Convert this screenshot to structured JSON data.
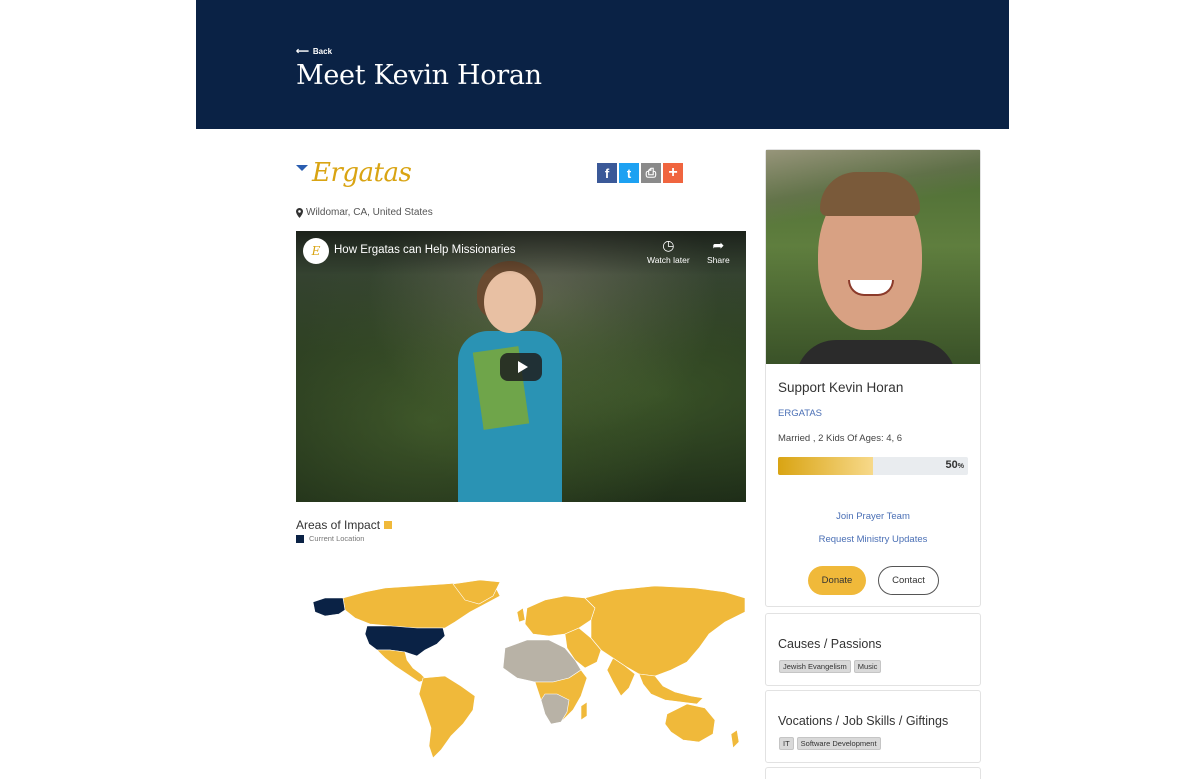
{
  "hero": {
    "back_label": "Back",
    "title": "Meet Kevin Horan"
  },
  "org": {
    "logo_text": "Ergatas",
    "location": "Wildomar, CA, United States"
  },
  "share": {
    "facebook": "f",
    "twitter": "t",
    "print": "⎙",
    "more": "+"
  },
  "video": {
    "channel_initial": "E",
    "title": "How Ergatas can Help Missionaries",
    "watch_later": "Watch later",
    "share": "Share"
  },
  "impact": {
    "title": "Areas of Impact",
    "legend_current": "Current Location",
    "colors": {
      "impact": "#f0b93a",
      "current": "#0a2245",
      "other": "#b8b2a6"
    }
  },
  "profile": {
    "support_title": "Support Kevin Horan",
    "org_name": "ERGATAS",
    "family": "Married , 2 Kids Of Ages: 4, 6",
    "progress_percent": 50,
    "progress_number": "50",
    "progress_unit": "%",
    "join_prayer": "Join Prayer Team",
    "request_updates": "Request Ministry Updates",
    "donate": "Donate",
    "contact": "Contact"
  },
  "causes": {
    "title": "Causes / Passions",
    "tags": [
      "Jewish Evangelism",
      "Music"
    ]
  },
  "vocations": {
    "title": "Vocations / Job Skills / Giftings",
    "tags": [
      "IT",
      "Software Development"
    ]
  }
}
